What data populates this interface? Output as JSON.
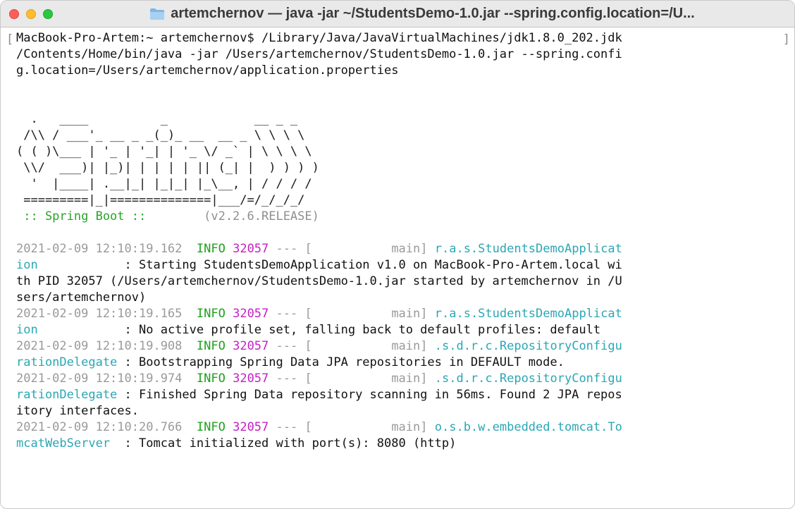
{
  "window": {
    "title": "artemchernov — java -jar ~/StudentsDemo-1.0.jar --spring.config.location=/U..."
  },
  "terminal": {
    "command_lines": [
      "MacBook-Pro-Artem:~ artemchernov$ /Library/Java/JavaVirtualMachines/jdk1.8.0_202.jdk",
      "/Contents/Home/bin/java -jar /Users/artemchernov/StudentsDemo-1.0.jar --spring.confi",
      "g.location=/Users/artemchernov/application.properties"
    ],
    "banner_lines": [
      "  .   ____          _            __ _ _",
      " /\\\\ / ___'_ __ _ _(_)_ __  __ _ \\ \\ \\ \\",
      "( ( )\\___ | '_ | '_| | '_ \\/ _` | \\ \\ \\ \\",
      " \\\\/  ___)| |_)| | | | | || (_| |  ) ) ) )",
      "  '  |____| .__|_| |_|_| |_\\__, | / / / /",
      " =========|_|==============|___/=/_/_/_/"
    ],
    "spring_label": " :: Spring Boot :: ",
    "spring_version": "       (v2.2.6.RELEASE)",
    "logs": [
      {
        "timestamp": "2021-02-09 12:10:19.162",
        "level": "INFO",
        "pid": "32057",
        "sep": "---",
        "thread": "[           main]",
        "logger_a": "r.a.s.StudentsDemoApplicat",
        "logger_b": "ion",
        "pad": "            ",
        "message_lines": [
          ": Starting StudentsDemoApplication v1.0 on MacBook-Pro-Artem.local wi",
          "th PID 32057 (/Users/artemchernov/StudentsDemo-1.0.jar started by artemchernov in /U",
          "sers/artemchernov)"
        ]
      },
      {
        "timestamp": "2021-02-09 12:10:19.165",
        "level": "INFO",
        "pid": "32057",
        "sep": "---",
        "thread": "[           main]",
        "logger_a": "r.a.s.StudentsDemoApplicat",
        "logger_b": "ion",
        "pad": "            ",
        "message_lines": [
          ": No active profile set, falling back to default profiles: default"
        ]
      },
      {
        "timestamp": "2021-02-09 12:10:19.908",
        "level": "INFO",
        "pid": "32057",
        "sep": "---",
        "thread": "[           main]",
        "logger_a": ".s.d.r.c.RepositoryConfigu",
        "logger_b": "rationDelegate",
        "pad": " ",
        "message_lines": [
          ": Bootstrapping Spring Data JPA repositories in DEFAULT mode."
        ]
      },
      {
        "timestamp": "2021-02-09 12:10:19.974",
        "level": "INFO",
        "pid": "32057",
        "sep": "---",
        "thread": "[           main]",
        "logger_a": ".s.d.r.c.RepositoryConfigu",
        "logger_b": "rationDelegate",
        "pad": " ",
        "message_lines": [
          ": Finished Spring Data repository scanning in 56ms. Found 2 JPA repos",
          "itory interfaces."
        ]
      },
      {
        "timestamp": "2021-02-09 12:10:20.766",
        "level": "INFO",
        "pid": "32057",
        "sep": "---",
        "thread": "[           main]",
        "logger_a": "o.s.b.w.embedded.tomcat.To",
        "logger_b": "mcatWebServer",
        "pad": "  ",
        "message_lines": [
          ": Tomcat initialized with port(s): 8080 (http)"
        ]
      }
    ]
  },
  "colors": {
    "level_info": "#1fa11f",
    "pid": "#c51fc5",
    "logger": "#2aa7b5",
    "timestamp": "#9a9a9a"
  },
  "icons": {
    "folder": "folder-icon",
    "close": "close-window-icon",
    "minimize": "minimize-window-icon",
    "maximize": "maximize-window-icon"
  }
}
